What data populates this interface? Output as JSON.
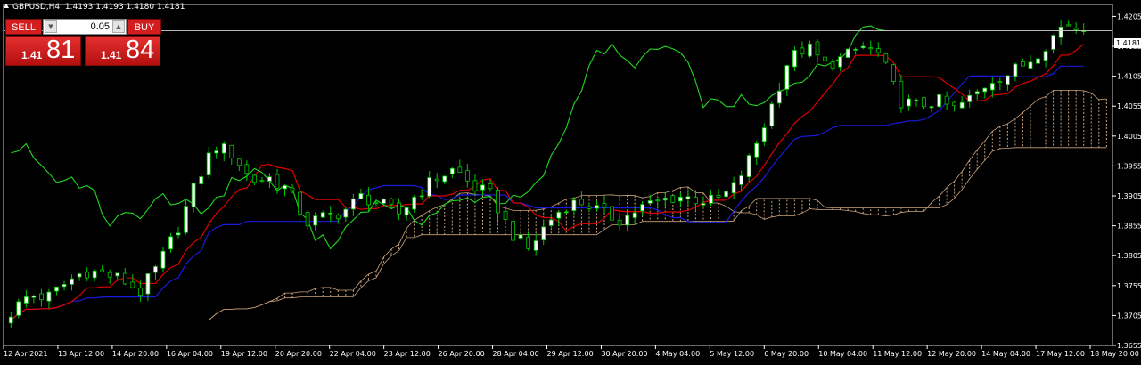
{
  "header": {
    "symbol_label": "GBPUSD,H4",
    "quote": "1.4193 1.4193 1.4180 1.4181"
  },
  "trade_panel": {
    "sell_label": "SELL",
    "buy_label": "BUY",
    "lot_value": "0.05",
    "sell_price_small": "1.41",
    "sell_price_big": "81",
    "buy_price_small": "1.41",
    "buy_price_big": "84"
  },
  "current_price_label": "1.4181",
  "colors": {
    "background": "#000000",
    "bull": "#ffffff",
    "bear": "#00c800",
    "tenkan": "#e00000",
    "kijun": "#1a1adc",
    "chikou": "#22d822",
    "cloud": "#c9a27a",
    "axis": "#ffffff"
  },
  "chart_data": {
    "type": "candlestick",
    "title": "GBPUSD,H4",
    "indicators": [
      "Ichimoku Kinko Hyo"
    ],
    "ylim": [
      1.3655,
      1.4225
    ],
    "y_ticks": [
      "1.4205",
      "1.4155",
      "1.4105",
      "1.4055",
      "1.4005",
      "1.3955",
      "1.3905",
      "1.3855",
      "1.3805",
      "1.3755",
      "1.3705",
      "1.3655"
    ],
    "x_tick_labels": [
      "12 Apr 2021",
      "13 Apr 12:00",
      "14 Apr 20:00",
      "16 Apr 04:00",
      "19 Apr 12:00",
      "20 Apr 20:00",
      "22 Apr 04:00",
      "23 Apr 12:00",
      "26 Apr 20:00",
      "28 Apr 04:00",
      "29 Apr 12:00",
      "30 Apr 20:00",
      "4 May 04:00",
      "5 May 12:00",
      "6 May 20:00",
      "10 May 04:00",
      "11 May 12:00",
      "12 May 20:00",
      "14 May 04:00",
      "17 May 12:00",
      "18 May 20:00"
    ],
    "close_keypoints": [
      1.371,
      1.374,
      1.3735,
      1.376,
      1.378,
      1.3775,
      1.3765,
      1.3745,
      1.379,
      1.385,
      1.3925,
      1.399,
      1.3975,
      1.393,
      1.3935,
      1.3915,
      1.386,
      1.387,
      1.388,
      1.3905,
      1.389,
      1.3875,
      1.391,
      1.3935,
      1.395,
      1.392,
      1.3905,
      1.3845,
      1.3815,
      1.386,
      1.389,
      1.3895,
      1.3875,
      1.3865,
      1.3885,
      1.3895,
      1.3905,
      1.39,
      1.3895,
      1.3915,
      1.397,
      1.4045,
      1.413,
      1.4155,
      1.4125,
      1.4135,
      1.4155,
      1.414,
      1.4065,
      1.4055,
      1.4065,
      1.405,
      1.407,
      1.41,
      1.411,
      1.413,
      1.416,
      1.4195,
      1.4181
    ],
    "current_price": 1.4181
  }
}
